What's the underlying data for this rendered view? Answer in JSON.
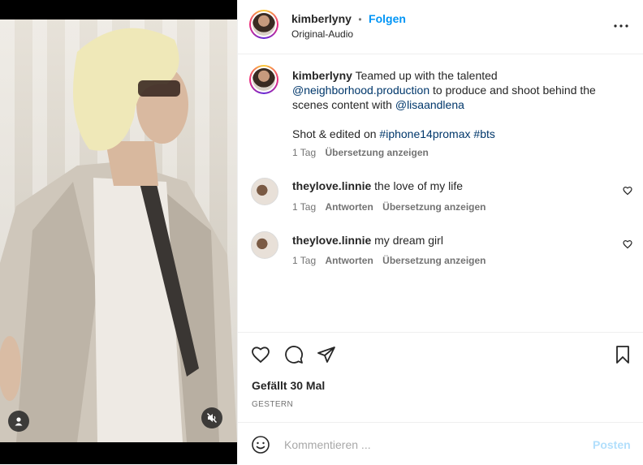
{
  "post": {
    "username": "kimberlyny",
    "dot": "•",
    "follow_label": "Folgen",
    "audio": "Original-Audio",
    "more_icon": "more-horizontal-icon"
  },
  "caption": {
    "username": "kimberlyny",
    "text1": "Teamed up with the talented",
    "mention1": "@neighborhood.production",
    "text2": "to produce and shoot behind the scenes content with",
    "mention2": "@lisaandlena",
    "line2_prefix": "Shot & edited on",
    "tag1": "#iphone14promax",
    "tag2": "#bts",
    "time": "1 Tag",
    "translate": "Übersetzung anzeigen"
  },
  "comments": [
    {
      "username": "theylove.linnie",
      "text": "the love of my life",
      "time": "1 Tag",
      "reply": "Antworten",
      "translate": "Übersetzung anzeigen"
    },
    {
      "username": "theylove.linnie",
      "text": "my dream girl",
      "time": "1 Tag",
      "reply": "Antworten",
      "translate": "Übersetzung anzeigen"
    }
  ],
  "actions": {
    "likes": "Gefällt 30 Mal",
    "date": "GESTERN"
  },
  "composer": {
    "placeholder": "Kommentieren ...",
    "post_label": "Posten"
  },
  "colors": {
    "link": "#00376b",
    "follow": "#0095f6",
    "post_disabled": "#b2dffc"
  }
}
